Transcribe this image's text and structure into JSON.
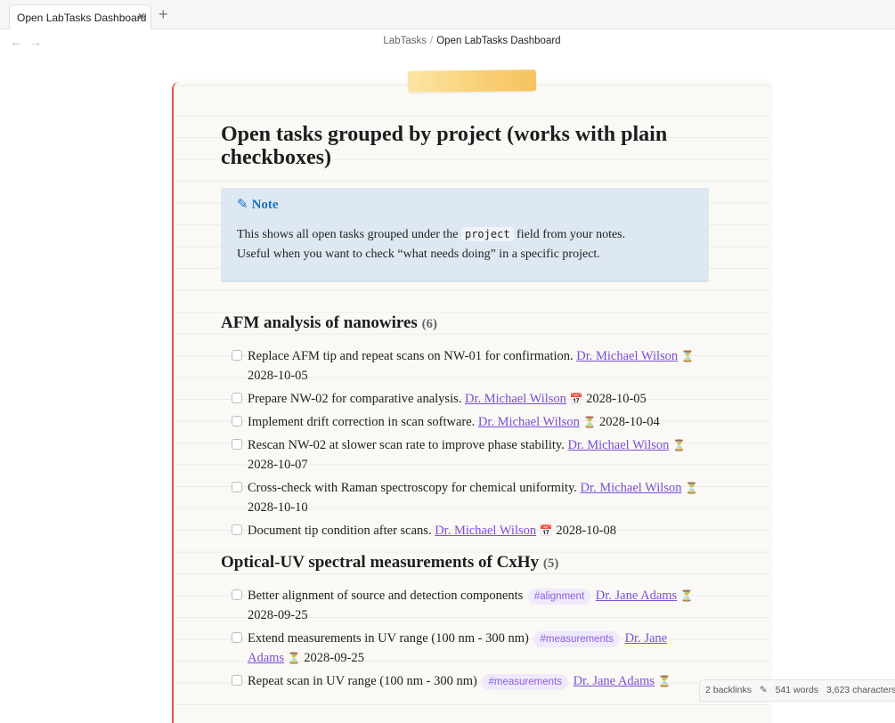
{
  "tab": {
    "title": "Open LabTasks Dashboard",
    "close_icon": "×",
    "new_tab_icon": "+"
  },
  "nav": {
    "back_icon": "←",
    "forward_icon": "→"
  },
  "breadcrumb": {
    "parent": "LabTasks",
    "separator": "/",
    "current": "Open LabTasks Dashboard"
  },
  "doc": {
    "title": "Open tasks grouped by project (works with plain checkboxes)",
    "callout": {
      "icon": "✎",
      "title": "Note",
      "line1_pre": "This shows all open tasks grouped under the ",
      "line1_code": "project",
      "line1_post": " field from your notes.",
      "line2": "Useful when you want to check “what needs doing” in a specific project."
    },
    "groups": [
      {
        "title": "AFM analysis of nanowires",
        "count": "(6)",
        "tasks": [
          {
            "text": "Replace AFM tip and repeat scans on NW-01 for confirmation.",
            "person": "Dr. Michael Wilson",
            "icon": "⏳",
            "date": "2028-10-05"
          },
          {
            "text": "Prepare NW-02 for comparative analysis.",
            "person": "Dr. Michael Wilson",
            "icon": "📅",
            "date": "2028-10-05"
          },
          {
            "text": "Implement drift correction in scan software.",
            "person": "Dr. Michael Wilson",
            "icon": "⏳",
            "date": "2028-10-04"
          },
          {
            "text": "Rescan NW-02 at slower scan rate to improve phase stability.",
            "person": "Dr. Michael Wilson",
            "icon": "⏳",
            "date": "2028-10-07"
          },
          {
            "text": "Cross-check with Raman spectroscopy for chemical uniformity.",
            "person": "Dr. Michael Wilson",
            "icon": "⏳",
            "date": "2028-10-10"
          },
          {
            "text": "Document tip condition after scans.",
            "person": "Dr. Michael Wilson",
            "icon": "📅",
            "date": "2028-10-08"
          }
        ]
      },
      {
        "title": "Optical-UV spectral measurements of CxHy",
        "count": "(5)",
        "tasks": [
          {
            "text": "Better alignment of source and detection components",
            "tag": "#alignment",
            "person": "Dr. Jane Adams",
            "icon": "⏳",
            "date": "2028-09-25"
          },
          {
            "text": "Extend measurements in UV range (100 nm - 300 nm)",
            "tag": "#measurements",
            "person_a": "Dr. Jane",
            "person_b": "Adams",
            "icon": "⏳",
            "date": "2028-09-25"
          },
          {
            "text": "Repeat scan in UV range (100 nm - 300 nm)",
            "tag": "#measurements",
            "person": "Dr. Jane Adams",
            "icon": "⏳"
          }
        ]
      }
    ]
  },
  "status": {
    "backlinks": "2 backlinks",
    "edit_icon": "✎",
    "words": "541 words",
    "characters": "3,623 characters"
  }
}
